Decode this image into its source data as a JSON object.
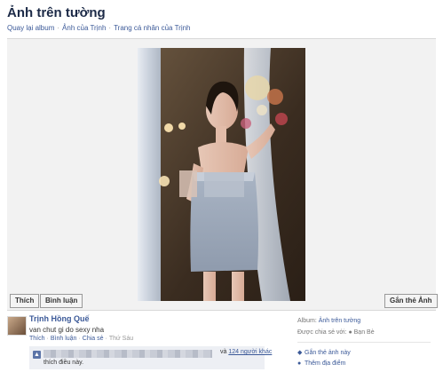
{
  "header": {
    "title": "Ảnh trên tường",
    "breadcrumbs": [
      "Quay lại album",
      "Ảnh của Trịnh",
      "Trang cá nhân của Trịnh"
    ],
    "separator": "·"
  },
  "photo_actions": {
    "like_label": "Thích",
    "comment_label": "Bình luận",
    "tag_label": "Gắn thẻ Ảnh"
  },
  "post": {
    "author": "Trịnh Hồng Quế",
    "caption": "van chut gi do sexy nha",
    "actions": [
      "Thích",
      "Bình luận",
      "Chia sẻ"
    ],
    "timestamp": "Thứ Sáu",
    "likes": {
      "icon": "thumbs-up-icon",
      "others_link": "124 người khác",
      "prefix": "và",
      "suffix": "thích điều này."
    }
  },
  "sidebar": {
    "album_label": "Album:",
    "album_value": "Ảnh trên tường",
    "shared_label": "Được chia sẻ với:",
    "shared_value": "Bạn Bè",
    "tag_link": "Gắn thẻ ảnh này",
    "location_link": "Thêm địa điểm"
  },
  "colors": {
    "link": "#3b5998",
    "title": "#1c2a47",
    "like_bg": "#edeff4"
  }
}
